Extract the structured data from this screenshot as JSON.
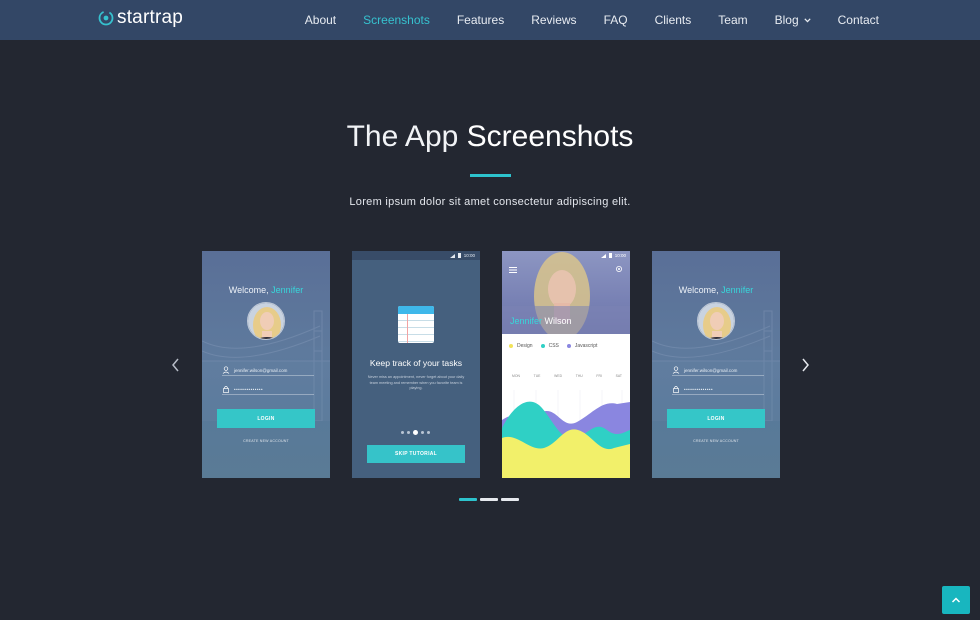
{
  "navbar": {
    "brand": "startrap",
    "items": [
      {
        "label": "About",
        "active": false
      },
      {
        "label": "Screenshots",
        "active": true
      },
      {
        "label": "Features",
        "active": false
      },
      {
        "label": "Reviews",
        "active": false
      },
      {
        "label": "FAQ",
        "active": false
      },
      {
        "label": "Clients",
        "active": false
      },
      {
        "label": "Team",
        "active": false
      },
      {
        "label": "Blog",
        "active": false,
        "dropdown": true
      },
      {
        "label": "Contact",
        "active": false
      }
    ]
  },
  "section": {
    "title_light": "The App",
    "title_bold": "Screenshots",
    "subtitle": "Lorem ipsum dolor sit amet consectetur adipiscing elit."
  },
  "screens": {
    "login": {
      "welcome": "Welcome,",
      "name": "Jennifer",
      "email": "jennifer.wilson@gmail.com",
      "password": "••••••••••••••",
      "button": "LOGIN",
      "create": "CREATE NEW ACCOUNT"
    },
    "tutorial": {
      "time": "10:00",
      "title": "Keep track of your tasks",
      "description": "Never miss an appointment, never forget about your daily team meeting and remember when you favorite team is playing.",
      "button": "SKIP TUTORIAL"
    },
    "profile": {
      "time": "10:00",
      "first_name": "Jennifer",
      "last_name": "Wilson",
      "legend": [
        {
          "label": "Design",
          "color": "#f2e35a"
        },
        {
          "label": "CSS",
          "color": "#2fd0c5"
        },
        {
          "label": "Javascript",
          "color": "#8a86e0"
        }
      ],
      "days": [
        "MON",
        "TUE",
        "WED",
        "THU",
        "FRI",
        "SAT"
      ]
    }
  },
  "colors": {
    "accent": "#2dc3cd",
    "navbar": "#334766",
    "background": "#232731"
  },
  "pager": {
    "count": 3,
    "active_index": 0
  }
}
